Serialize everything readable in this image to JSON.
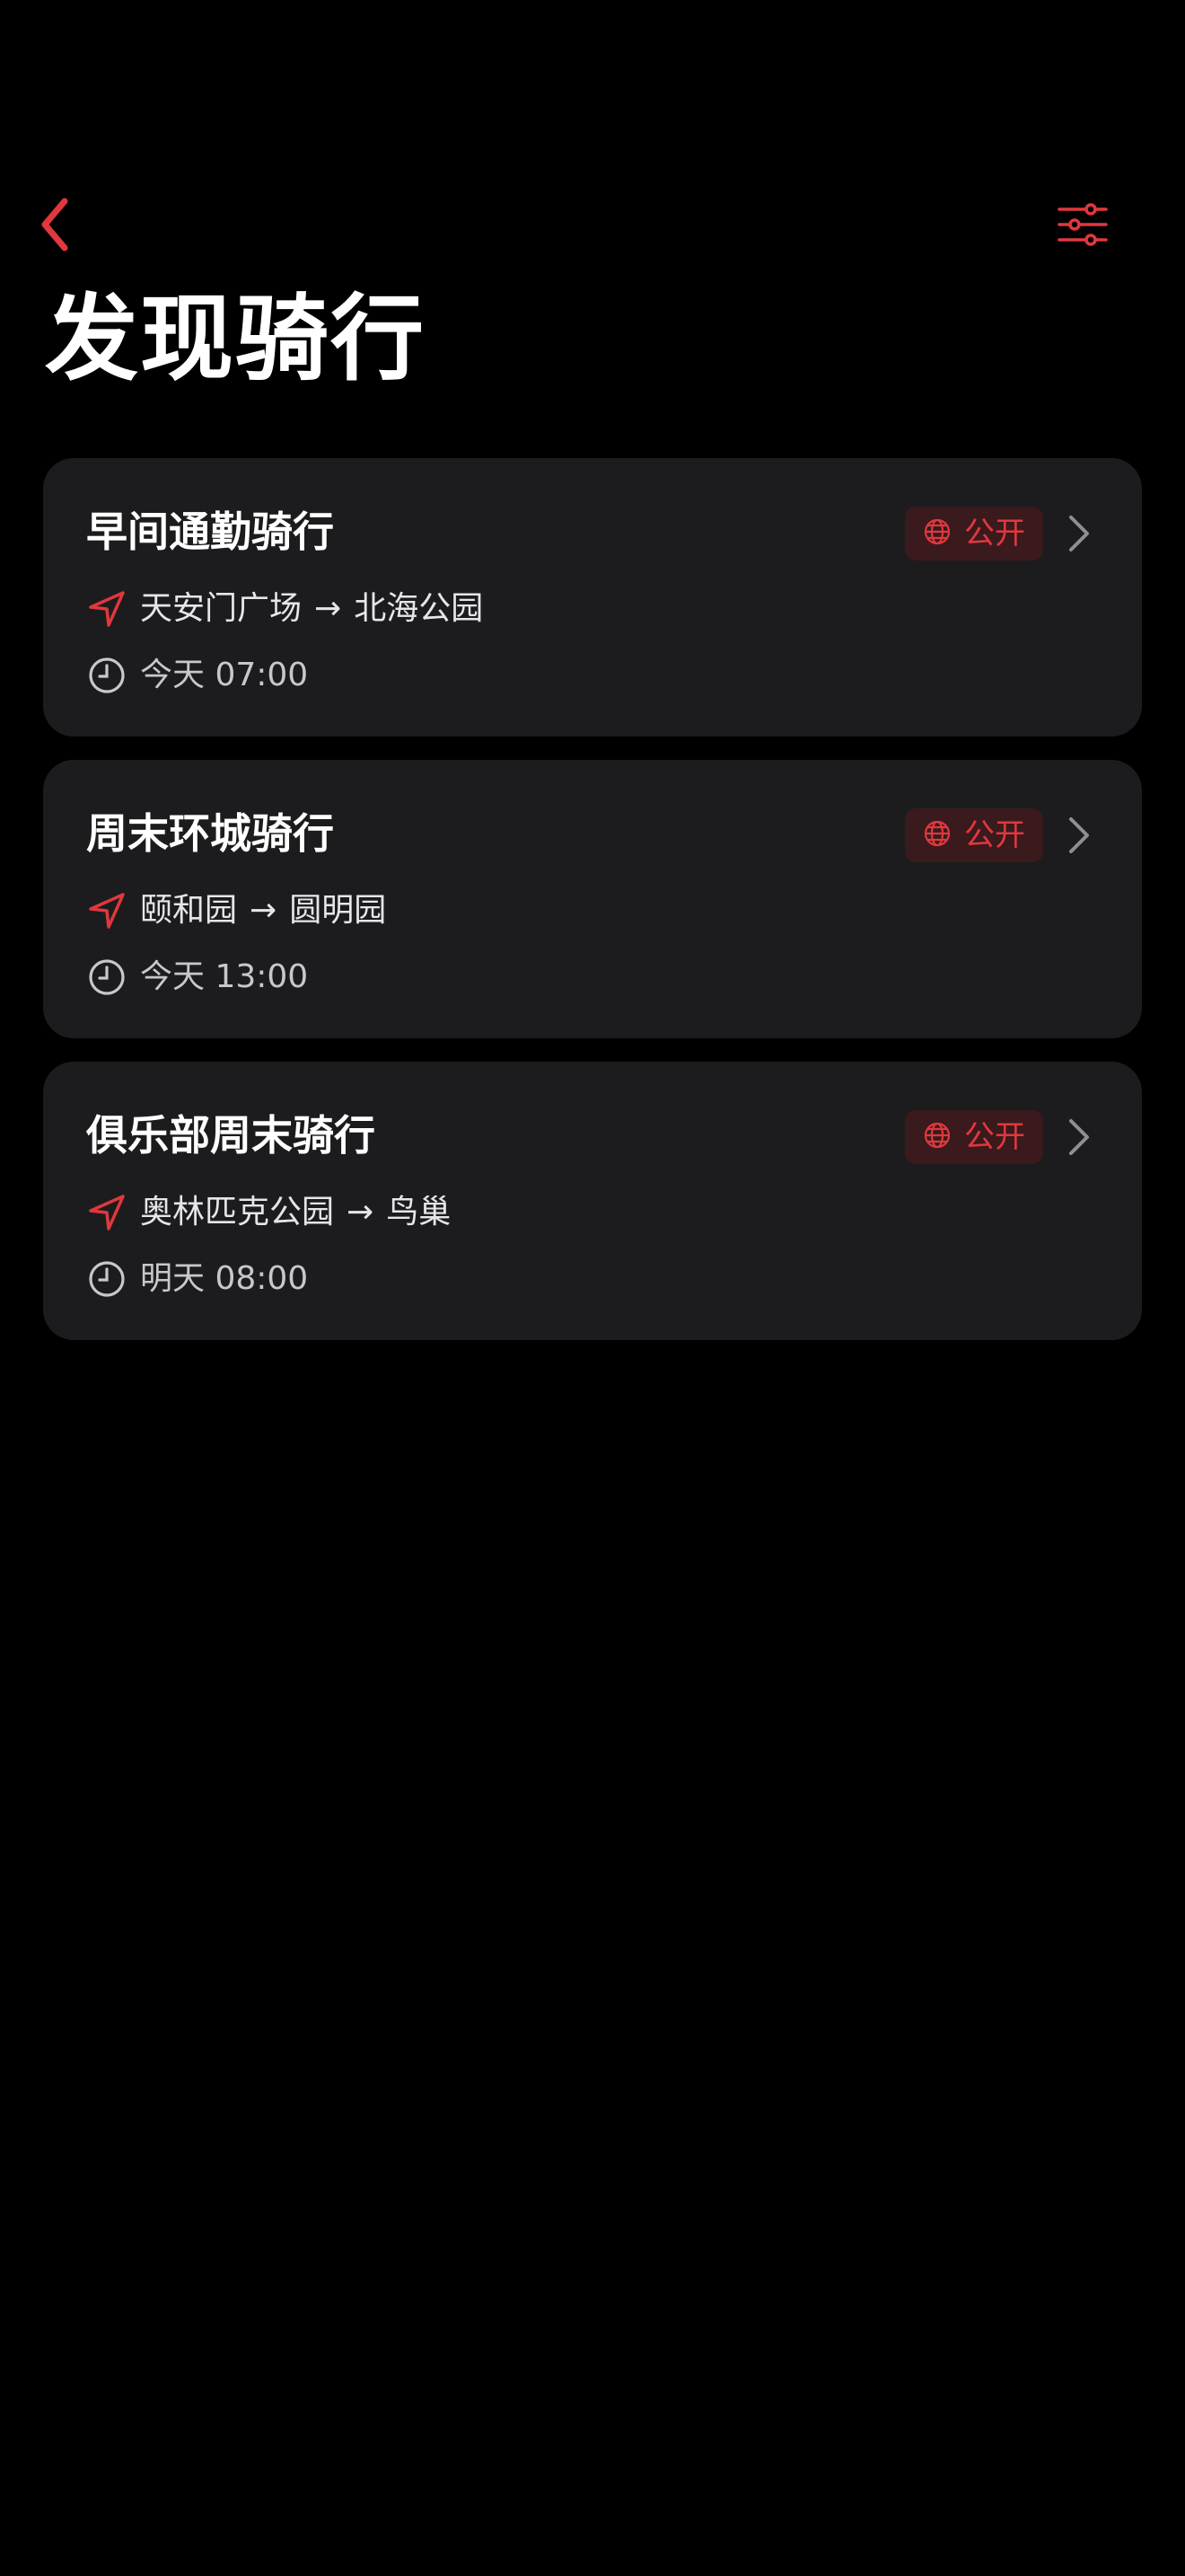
{
  "header": {
    "title": "发现骑行",
    "back_icon": "chevron-left-icon",
    "filter_icon": "sliders-icon",
    "accent_color": "#e0383e"
  },
  "badge": {
    "label": "公开",
    "icon": "globe-icon"
  },
  "route_arrow": "→",
  "rides": [
    {
      "name": "早间通勤骑行",
      "from": "天安门广场",
      "to": "北海公园",
      "time": "今天 07:00"
    },
    {
      "name": "周末环城骑行",
      "from": "颐和园",
      "to": "圆明园",
      "time": "今天 13:00"
    },
    {
      "name": "俱乐部周末骑行",
      "from": "奥林匹克公园",
      "to": "鸟巢",
      "time": "明天 08:00"
    }
  ]
}
